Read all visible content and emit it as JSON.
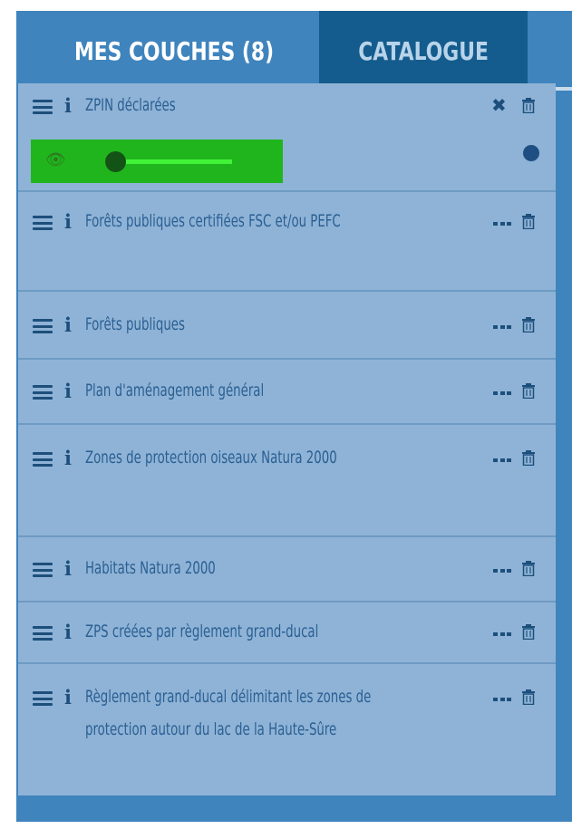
{
  "tabs": {
    "my_layers": "MES COUCHES (8)",
    "catalogue": "CATALOGUE"
  },
  "layers": [
    {
      "name": "ZPIN déclarées",
      "actions": "close"
    },
    {
      "name": "Forêts publiques certifiées FSC et/ou PEFC",
      "actions": "menu"
    },
    {
      "name": "Forêts publiques",
      "actions": "menu"
    },
    {
      "name": "Plan d'aménagement général",
      "actions": "menu"
    },
    {
      "name": "Zones de protection oiseaux Natura 2000",
      "actions": "menu"
    },
    {
      "name": "Habitats Natura 2000",
      "actions": "menu"
    },
    {
      "name": "ZPS créées par règlement grand-ducal",
      "actions": "menu"
    },
    {
      "name": "Règlement grand-ducal délimitant les zones de protection autour du lac de la Haute-Sûre",
      "actions": "menu"
    }
  ],
  "icons": {
    "drag_handle": "hamburger-icon",
    "info": "info-icon",
    "close": "close-icon",
    "menu": "ellipsis-icon",
    "delete": "trash-icon",
    "visibility": "eye-slash-icon"
  },
  "colors": {
    "panel": "#3f84bd",
    "list_background": "#8fb3d6",
    "inactive_tab": "#145c8d",
    "opacity_control": "#21b51d",
    "slider_track": "#41f338"
  },
  "opacity_slider": {
    "value": 0
  }
}
